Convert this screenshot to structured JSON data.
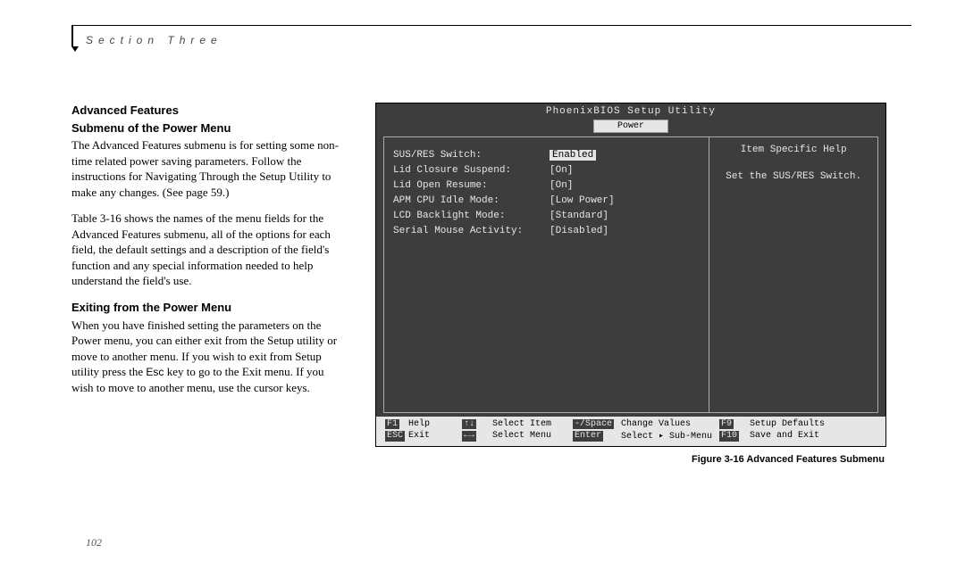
{
  "header": {
    "section_label": "Section Three"
  },
  "left": {
    "heading_line1": "Advanced Features",
    "heading_line2": "Submenu of the Power Menu",
    "para1": "The Advanced Features submenu is for setting some non-time related power saving parameters. Follow the instructions for Navigating Through the Setup Utility to make any changes. (See page 59.)",
    "para2": "Table 3-16 shows the names of the menu fields for the Advanced Features submenu, all of the options for each field, the default settings and a description of the field's function and any special information needed to help understand the field's use.",
    "subhead": "Exiting from the Power Menu",
    "para3_a": "When you have finished setting the parameters on the Power menu, you can either exit from the Setup utility or move to another menu. If you wish to exit from Setup utility press the ",
    "esc_key": "Esc",
    "para3_b": " key to go to the Exit menu. If you wish to move to another menu, use the cursor keys."
  },
  "bios": {
    "title": "PhoenixBIOS Setup Utility",
    "tab": "Power",
    "help_title": "Item Specific Help",
    "help_text": "Set the SUS/RES Switch.",
    "rows": [
      {
        "label": "SUS/RES Switch:",
        "value": "Enabled",
        "selected": true
      },
      {
        "label": "Lid Closure Suspend:",
        "value": "[On]",
        "selected": false
      },
      {
        "label": "Lid Open Resume:",
        "value": "[On]",
        "selected": false
      },
      {
        "label": "APM CPU Idle Mode:",
        "value": "[Low Power]",
        "selected": false
      },
      {
        "label": "LCD Backlight Mode:",
        "value": "[Standard]",
        "selected": false
      },
      {
        "label": "Serial Mouse Activity:",
        "value": "[Disabled]",
        "selected": false
      }
    ],
    "footer": {
      "f1": "F1",
      "help": "Help",
      "updown": "↑↓",
      "select_item": "Select Item",
      "chg_key": "-/Space",
      "change_values": "Change Values",
      "f9": "F9",
      "setup_defaults": "Setup Defaults",
      "esc": "ESC",
      "exit": "Exit",
      "leftright": "←→",
      "select_menu": "Select Menu",
      "enter": "Enter",
      "select_sub": "Select ▸ Sub-Menu",
      "f10": "F10",
      "save_exit": "Save and Exit"
    }
  },
  "caption": "Figure 3-16 Advanced Features Submenu",
  "page_number": "102"
}
